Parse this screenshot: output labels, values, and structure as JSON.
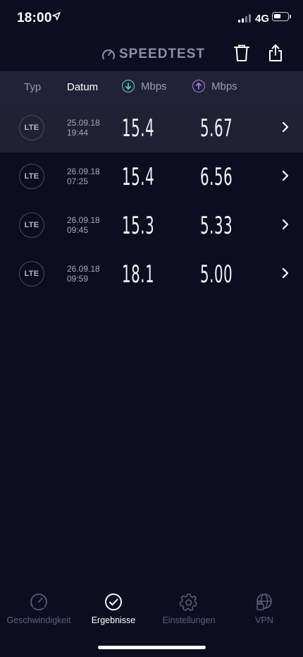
{
  "status_bar": {
    "time": "18:00",
    "network": "4G"
  },
  "header": {
    "logo_text": "SPEEDTEST"
  },
  "columns": {
    "type": "Typ",
    "date": "Datum",
    "download": "Mbps",
    "upload": "Mbps"
  },
  "results": [
    {
      "type": "LTE",
      "date": "25.09.18",
      "time": "19:44",
      "download": "15.4",
      "upload": "5.67"
    },
    {
      "type": "LTE",
      "date": "26.09.18",
      "time": "07:25",
      "download": "15.4",
      "upload": "6.56"
    },
    {
      "type": "LTE",
      "date": "26.09.18",
      "time": "09:45",
      "download": "15.3",
      "upload": "5.33"
    },
    {
      "type": "LTE",
      "date": "26.09.18",
      "time": "09:59",
      "download": "18.1",
      "upload": "5.00"
    }
  ],
  "tabbar": {
    "speed": "Geschwindigkeit",
    "results": "Ergebnisse",
    "settings": "Einstellungen",
    "vpn": "VPN"
  },
  "colors": {
    "background": "#0c0d1f",
    "header_bar": "#212236",
    "download_accent": "#5fd6e0",
    "upload_accent": "#b27cf0",
    "inactive_text": "#5f6078"
  },
  "icons": [
    "location-arrow-icon",
    "signal-icon",
    "battery-icon",
    "speedometer-icon",
    "trash-icon",
    "share-icon",
    "download-arrow-icon",
    "upload-arrow-icon",
    "chevron-right-icon",
    "checkmark-circle-icon",
    "gear-icon",
    "globe-lock-icon"
  ]
}
